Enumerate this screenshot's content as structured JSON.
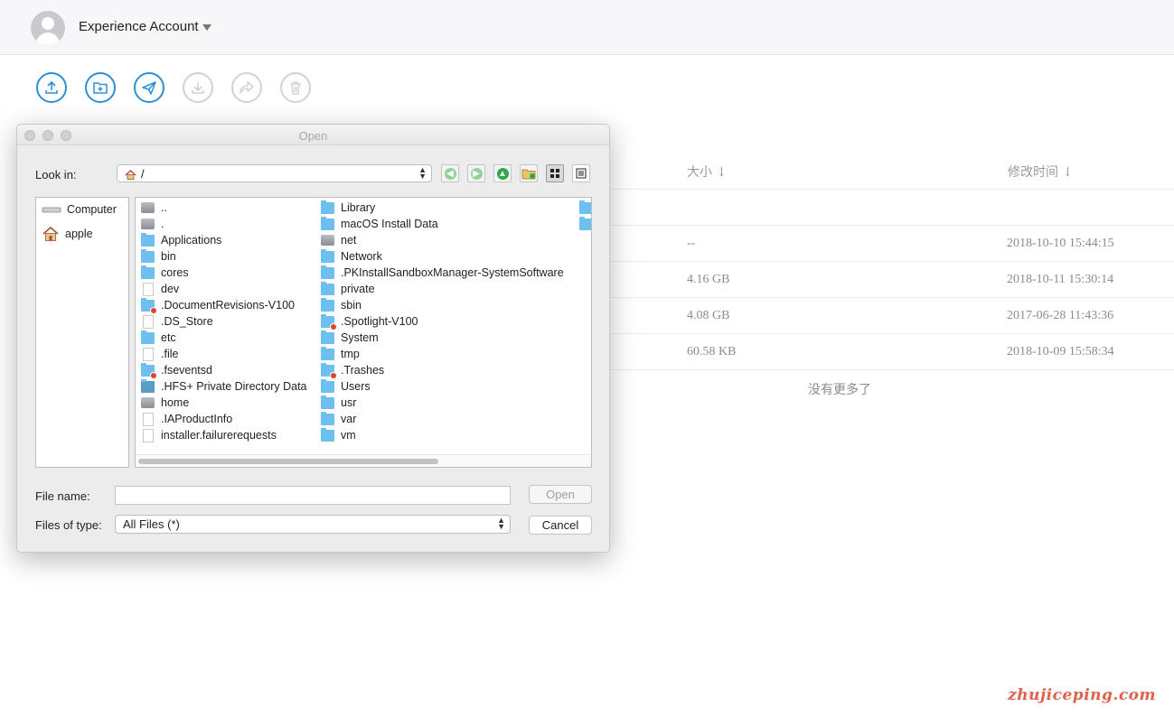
{
  "header": {
    "account_name": "Experience Account",
    "avatar_icon": "user-avatar-icon",
    "caret_icon": "caret-down-icon"
  },
  "toolbar": {
    "buttons": [
      {
        "name": "upload",
        "icon": "upload-icon",
        "enabled": true
      },
      {
        "name": "new-folder",
        "icon": "new-folder-icon",
        "enabled": true
      },
      {
        "name": "send",
        "icon": "paper-plane-icon",
        "enabled": true
      },
      {
        "name": "download",
        "icon": "download-icon",
        "enabled": false
      },
      {
        "name": "share",
        "icon": "share-icon",
        "enabled": false
      },
      {
        "name": "delete",
        "icon": "trash-icon",
        "enabled": false
      }
    ],
    "accent": "#2b8fd8",
    "disabled_color": "#cfd2d6"
  },
  "file_list": {
    "columns": {
      "size": "大小 ↓",
      "modified": "修改时间 ↓"
    },
    "rows": [
      {
        "size": "--",
        "modified": "2018-10-10 15:44:15"
      },
      {
        "size": "4.16 GB",
        "modified": "2018-10-11 15:30:14"
      },
      {
        "size": "4.08 GB",
        "modified": "2017-06-28 11:43:36"
      },
      {
        "size": "60.58 KB",
        "modified": "2018-10-09 15:58:34"
      }
    ],
    "footer": "没有更多了"
  },
  "watermark": "zhujiceping.com",
  "dialog": {
    "title": "Open",
    "look_in_label": "Look in:",
    "look_in_value": "/",
    "nav_buttons": [
      "back-arrow-icon",
      "forward-arrow-icon",
      "up-arrow-icon",
      "new-folder-icon",
      "icon-view-icon",
      "list-view-icon"
    ],
    "sidebar": [
      {
        "label": "Computer",
        "icon": "computer-icon"
      },
      {
        "label": "apple",
        "icon": "home-icon"
      }
    ],
    "files_col1": [
      {
        "name": "..",
        "type": "drive"
      },
      {
        "name": ".",
        "type": "drive"
      },
      {
        "name": "Applications",
        "type": "folder"
      },
      {
        "name": "bin",
        "type": "folder"
      },
      {
        "name": "cores",
        "type": "folder"
      },
      {
        "name": "dev",
        "type": "doc"
      },
      {
        "name": ".DocumentRevisions-V100",
        "type": "folder-locked"
      },
      {
        "name": ".DS_Store",
        "type": "doc"
      },
      {
        "name": "etc",
        "type": "folder"
      },
      {
        "name": ".file",
        "type": "doc"
      },
      {
        "name": ".fseventsd",
        "type": "folder-locked"
      },
      {
        "name": ".HFS+ Private Directory Data",
        "type": "folder-dark"
      },
      {
        "name": "home",
        "type": "drive"
      },
      {
        "name": ".IAProductInfo",
        "type": "doc"
      },
      {
        "name": "installer.failurerequests",
        "type": "doc"
      }
    ],
    "files_col2": [
      {
        "name": "Library",
        "type": "folder"
      },
      {
        "name": "macOS Install Data",
        "type": "folder"
      },
      {
        "name": "net",
        "type": "drive"
      },
      {
        "name": "Network",
        "type": "folder"
      },
      {
        "name": ".PKInstallSandboxManager-SystemSoftware",
        "type": "folder"
      },
      {
        "name": "private",
        "type": "folder"
      },
      {
        "name": "sbin",
        "type": "folder"
      },
      {
        "name": ".Spotlight-V100",
        "type": "folder-locked"
      },
      {
        "name": "System",
        "type": "folder"
      },
      {
        "name": "tmp",
        "type": "folder"
      },
      {
        "name": ".Trashes",
        "type": "folder-locked"
      },
      {
        "name": "Users",
        "type": "folder"
      },
      {
        "name": "usr",
        "type": "folder"
      },
      {
        "name": "var",
        "type": "folder"
      },
      {
        "name": "vm",
        "type": "folder"
      }
    ],
    "file_name_label": "File name:",
    "file_name_value": "",
    "file_type_label": "Files of type:",
    "file_type_value": "All Files (*)",
    "open_label": "Open",
    "cancel_label": "Cancel"
  }
}
